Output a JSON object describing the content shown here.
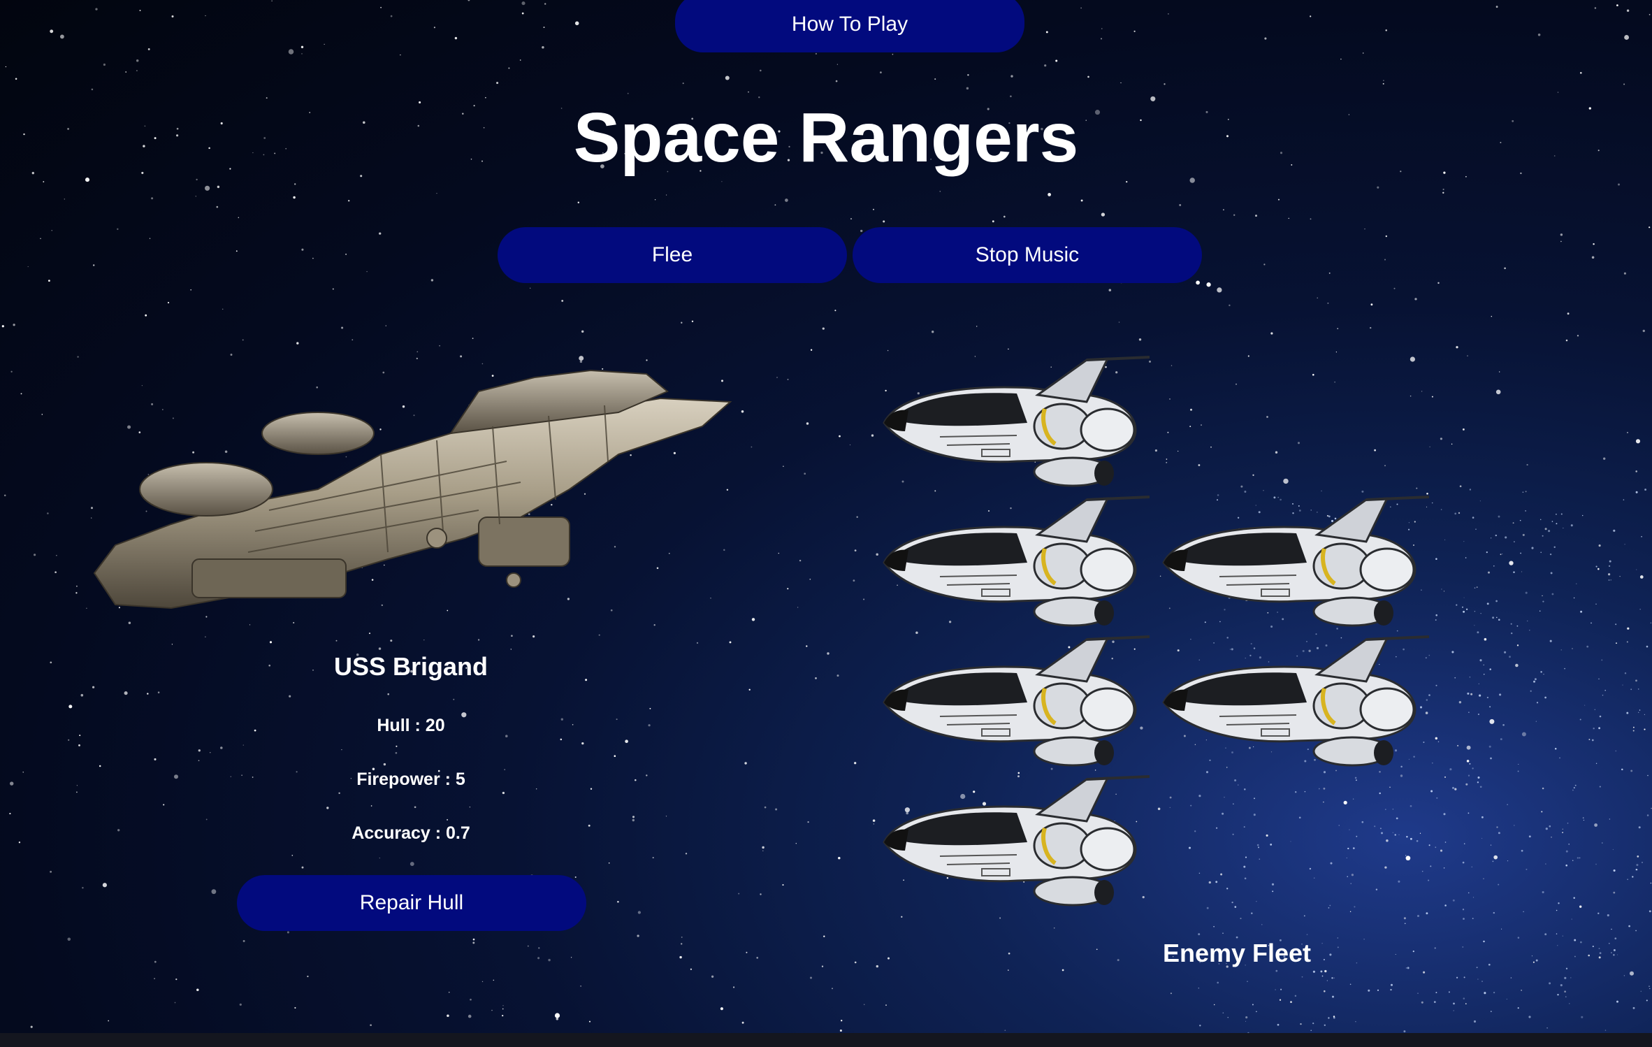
{
  "header": {
    "how_to_play_label": "How To Play",
    "title": "Space Rangers"
  },
  "controls": {
    "flee_label": "Flee",
    "stop_music_label": "Stop Music"
  },
  "player": {
    "name": "USS Brigand",
    "hull_text": "Hull : 20",
    "firepower_text": "Firepower : 5",
    "accuracy_text": "Accuracy : 0.7",
    "repair_label": "Repair Hull"
  },
  "enemy": {
    "label": "Enemy Fleet",
    "ship_count": 6
  },
  "colors": {
    "button": "#020a7e",
    "text": "#ffffff",
    "background": "#040a1f"
  }
}
